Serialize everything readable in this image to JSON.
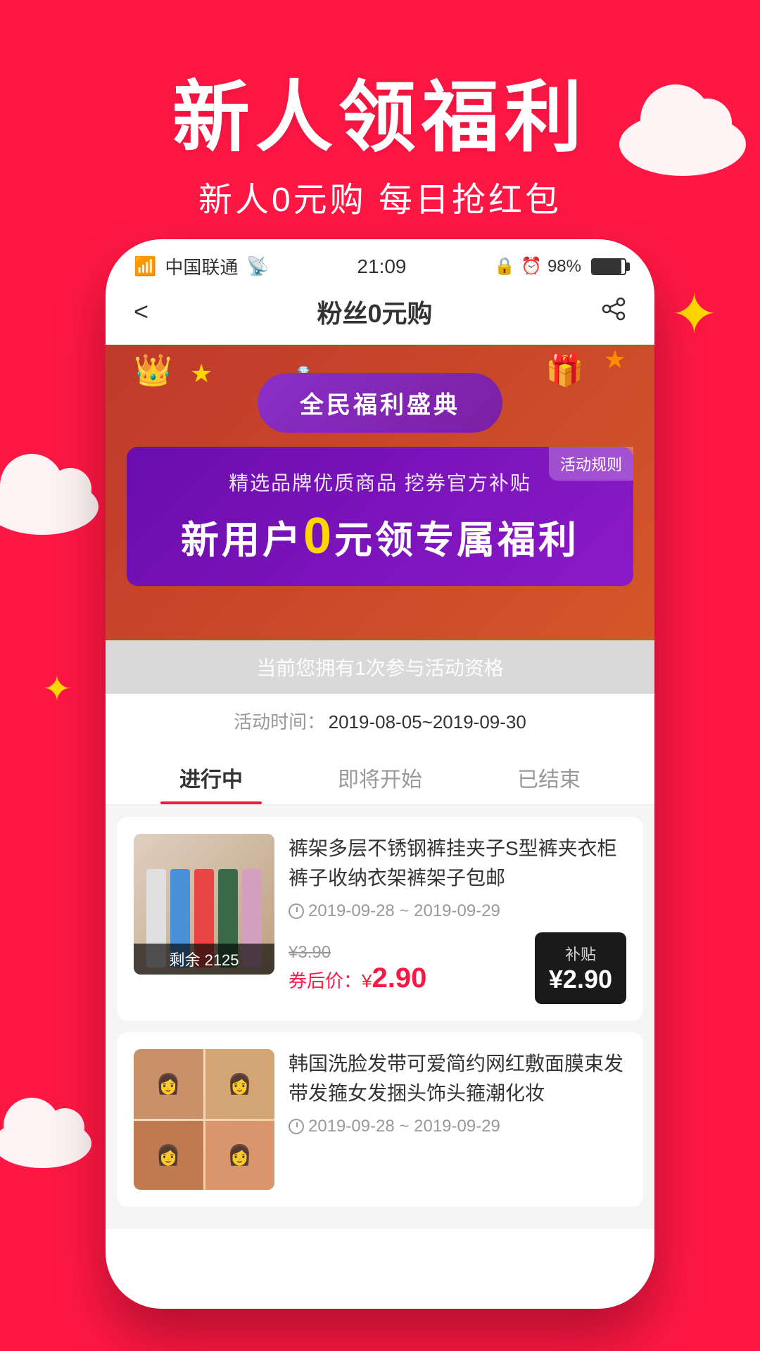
{
  "app": {
    "background_color": "#FF1744"
  },
  "hero": {
    "title": "新人领福利",
    "subtitle": "新人0元购 每日抢红包"
  },
  "status_bar": {
    "carrier": "中国联通",
    "time": "21:09",
    "battery_percent": "98%"
  },
  "nav": {
    "title": "粉丝0元购",
    "back_label": "‹",
    "share_label": "⬆"
  },
  "banner": {
    "festival_label": "全民福利盛典",
    "rules_label": "活动规则",
    "promo_subtitle": "精选品牌优质商品 挖券官方补贴",
    "promo_main_prefix": "新用户",
    "promo_main_zero": "0",
    "promo_main_suffix": "元领专属福利",
    "activity_tip": "当前您拥有1次参与活动资格",
    "activity_time_label": "活动时间：",
    "activity_time_value": "2019-08-05~2019-09-30"
  },
  "tabs": [
    {
      "label": "进行中",
      "active": true
    },
    {
      "label": "即将开始",
      "active": false
    },
    {
      "label": "已结束",
      "active": false
    }
  ],
  "products": [
    {
      "title": "裤架多层不锈钢裤挂夹子S型裤夹衣柜裤子收纳衣架裤架子包邮",
      "date_range": "2019-09-28 ~ 2019-09-29",
      "original_price": "¥3.90",
      "coupon_price": "券后价：¥",
      "coupon_amount": "2.90",
      "remaining": "剩余 2125",
      "subsidy_label": "补贴",
      "subsidy_amount": "¥2.90",
      "hanger_colors": [
        "#e8e8e8",
        "#4a90d9",
        "#e84545",
        "#3a6a4a",
        "#d4a0c0",
        "#8b6a4a",
        "#c0c0c0"
      ]
    },
    {
      "title": "韩国洗脸发带可爱简约网红敷面膜束发带发箍女发捆头饰头箍潮化妆",
      "date_range": "2019-09-28 ~ 2019-09-29",
      "original_price": "",
      "coupon_price": "",
      "coupon_amount": "",
      "remaining": "",
      "subsidy_label": "",
      "subsidy_amount": ""
    }
  ]
}
